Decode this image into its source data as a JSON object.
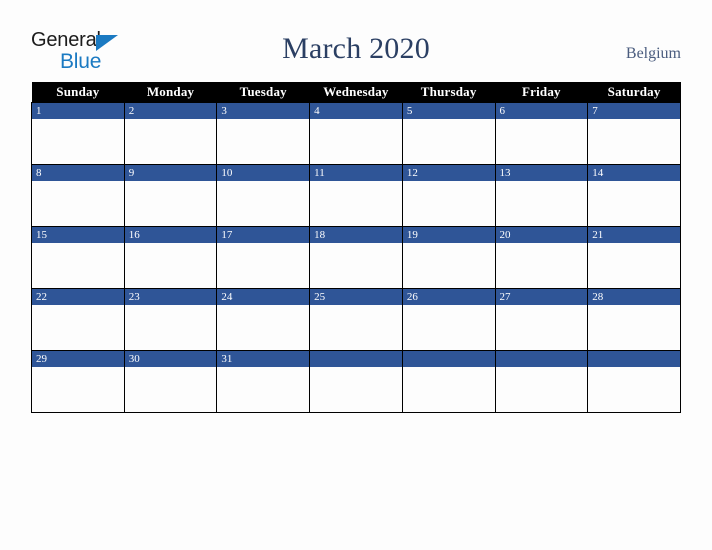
{
  "logo": {
    "word_one": "General",
    "word_two": "Blue",
    "triangle_icon": "triangle-icon",
    "blue": "#1b7ac2",
    "dark": "#1c1c1c"
  },
  "header": {
    "title": "March 2020",
    "country": "Belgium",
    "title_color": "#2b3f63",
    "country_color": "#4a5c7e"
  },
  "calendar": {
    "weekday_headers": [
      "Sunday",
      "Monday",
      "Tuesday",
      "Wednesday",
      "Thursday",
      "Friday",
      "Saturday"
    ],
    "header_bg": "#000000",
    "header_fg": "#ffffff",
    "daynum_bg": "#2f5597",
    "daynum_fg": "#ffffff",
    "cell_bg": "#fdfdfd",
    "border_color": "#000000",
    "weeks": [
      [
        "1",
        "2",
        "3",
        "4",
        "5",
        "6",
        "7"
      ],
      [
        "8",
        "9",
        "10",
        "11",
        "12",
        "13",
        "14"
      ],
      [
        "15",
        "16",
        "17",
        "18",
        "19",
        "20",
        "21"
      ],
      [
        "22",
        "23",
        "24",
        "25",
        "26",
        "27",
        "28"
      ],
      [
        "29",
        "30",
        "31",
        "",
        "",
        "",
        ""
      ]
    ]
  }
}
